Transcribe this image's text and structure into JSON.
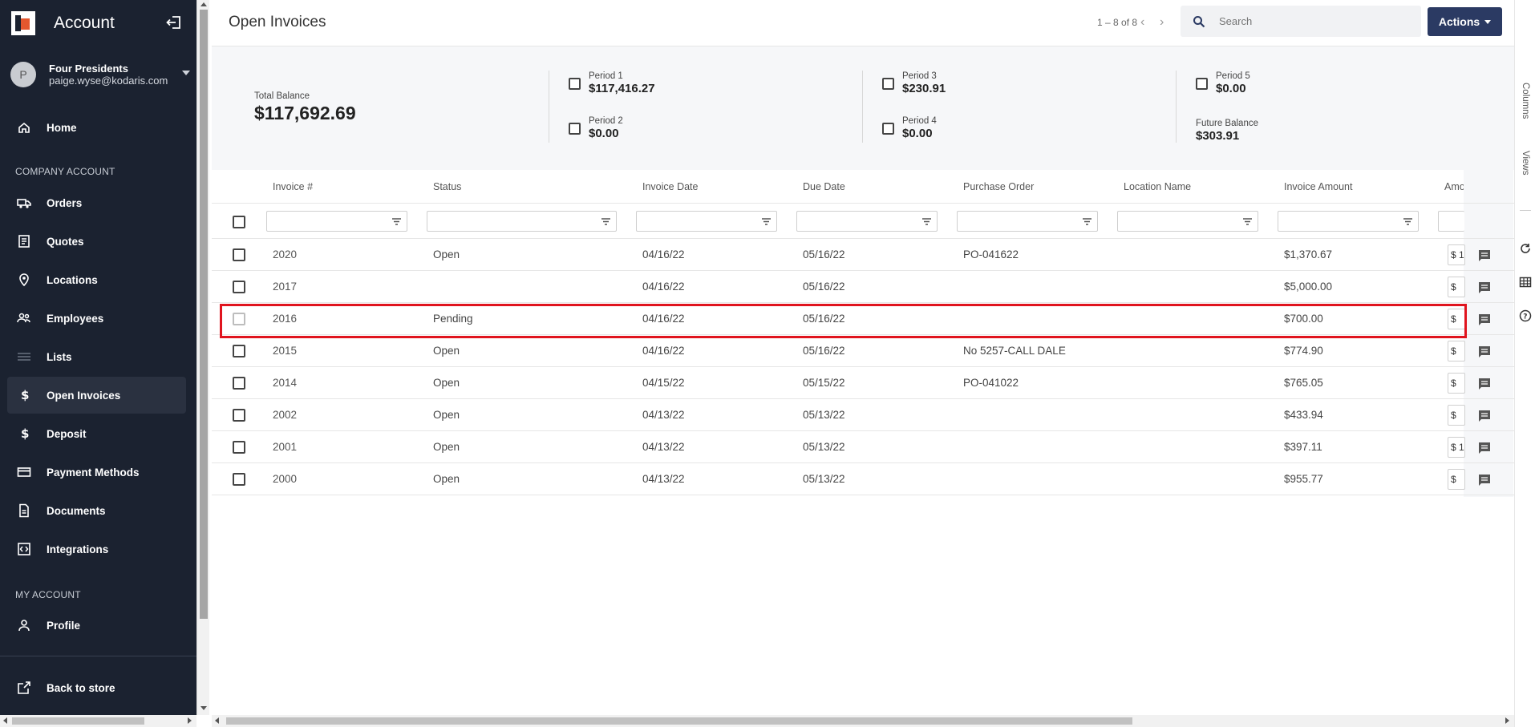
{
  "sidebar": {
    "title": "Account",
    "user": {
      "initial": "P",
      "company": "Four Presidents",
      "email": "paige.wyse@kodaris.com"
    },
    "items": [
      {
        "label": "Home",
        "icon": "home-icon"
      },
      {
        "label": "Orders",
        "icon": "truck-icon"
      },
      {
        "label": "Quotes",
        "icon": "quote-icon"
      },
      {
        "label": "Locations",
        "icon": "location-pin-icon"
      },
      {
        "label": "Employees",
        "icon": "people-icon"
      },
      {
        "label": "Lists",
        "icon": "list-icon"
      },
      {
        "label": "Open Invoices",
        "icon": "dollar-icon",
        "active": true
      },
      {
        "label": "Deposit",
        "icon": "dollar-icon"
      },
      {
        "label": "Payment Methods",
        "icon": "card-icon"
      },
      {
        "label": "Documents",
        "icon": "document-icon"
      },
      {
        "label": "Integrations",
        "icon": "integration-icon"
      },
      {
        "label": "Profile",
        "icon": "person-icon"
      }
    ],
    "sections": {
      "company": "COMPANY ACCOUNT",
      "my": "MY ACCOUNT"
    },
    "back_to_store": "Back to store"
  },
  "header": {
    "title": "Open Invoices",
    "pager": "1 – 8 of 8",
    "search_placeholder": "Search",
    "actions_label": "Actions"
  },
  "summary": {
    "total_label": "Total Balance",
    "total_value": "$117,692.69",
    "periods": [
      {
        "label": "Period 1",
        "value": "$117,416.27"
      },
      {
        "label": "Period 2",
        "value": "$0.00"
      },
      {
        "label": "Period 3",
        "value": "$230.91"
      },
      {
        "label": "Period 4",
        "value": "$0.00"
      },
      {
        "label": "Period 5",
        "value": "$0.00"
      }
    ],
    "future_label": "Future Balance",
    "future_value": "$303.91"
  },
  "table": {
    "columns": [
      "Invoice #",
      "Status",
      "Invoice Date",
      "Due Date",
      "Purchase Order",
      "Location Name",
      "Invoice Amount",
      "Amo"
    ],
    "rows": [
      {
        "invoice": "2020",
        "status": "Open",
        "invoice_date": "04/16/22",
        "due_date": "05/16/22",
        "po": "PO-041622",
        "location": "",
        "amount": "$1,370.67",
        "amo": "$ 1"
      },
      {
        "invoice": "2017",
        "status": "",
        "invoice_date": "04/16/22",
        "due_date": "05/16/22",
        "po": "",
        "location": "",
        "amount": "$5,000.00",
        "amo": "$"
      },
      {
        "invoice": "2016",
        "status": "Pending",
        "invoice_date": "04/16/22",
        "due_date": "05/16/22",
        "po": "",
        "location": "",
        "amount": "$700.00",
        "amo": "$"
      },
      {
        "invoice": "2015",
        "status": "Open",
        "invoice_date": "04/16/22",
        "due_date": "05/16/22",
        "po": "No 5257-CALL DALE",
        "location": "",
        "amount": "$774.90",
        "amo": "$"
      },
      {
        "invoice": "2014",
        "status": "Open",
        "invoice_date": "04/15/22",
        "due_date": "05/15/22",
        "po": "PO-041022",
        "location": "",
        "amount": "$765.05",
        "amo": "$"
      },
      {
        "invoice": "2002",
        "status": "Open",
        "invoice_date": "04/13/22",
        "due_date": "05/13/22",
        "po": "",
        "location": "",
        "amount": "$433.94",
        "amo": "$"
      },
      {
        "invoice": "2001",
        "status": "Open",
        "invoice_date": "04/13/22",
        "due_date": "05/13/22",
        "po": "",
        "location": "",
        "amount": "$397.11",
        "amo": "$ 1"
      },
      {
        "invoice": "2000",
        "status": "Open",
        "invoice_date": "04/13/22",
        "due_date": "05/13/22",
        "po": "",
        "location": "",
        "amount": "$955.77",
        "amo": "$"
      }
    ]
  },
  "rail": {
    "columns": "Columns",
    "views": "Views"
  },
  "colors": {
    "sidebar_bg": "#1b2230",
    "accent": "#2b3a63",
    "logo_orange": "#e4572e",
    "highlight": "#e0141e"
  }
}
